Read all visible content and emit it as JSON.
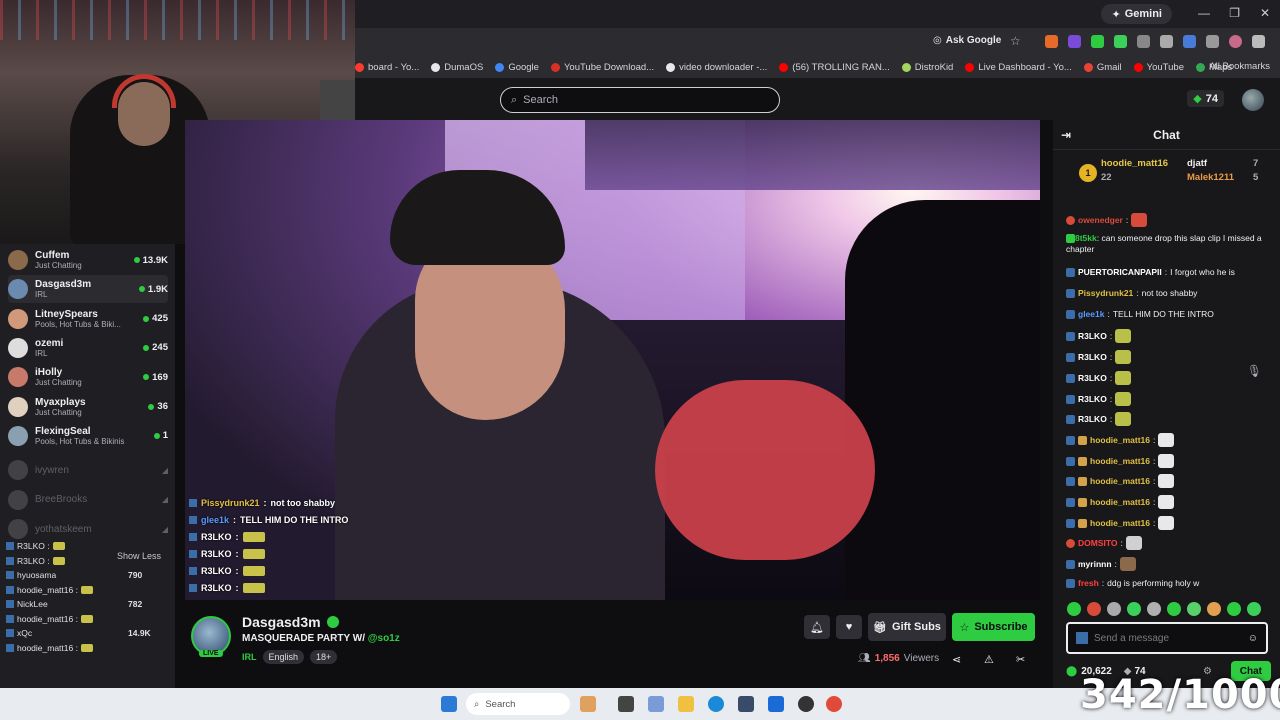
{
  "browser": {
    "gemini_label": "Gemini",
    "ask_google": "Ask Google",
    "bookmarks": [
      {
        "label": "board - Yo...",
        "color": "#ff3b30"
      },
      {
        "label": "DumaOS",
        "color": "#e8e8ea"
      },
      {
        "label": "Google",
        "color": "#4285f4"
      },
      {
        "label": "YouTube Download...",
        "color": "#d93025"
      },
      {
        "label": "video downloader -...",
        "color": "#e8e8ea"
      },
      {
        "label": "(56) TROLLING RAN...",
        "color": "#ff0000"
      },
      {
        "label": "DistroKid",
        "color": "#a3d65c"
      },
      {
        "label": "Live Dashboard - Yo...",
        "color": "#ff0000"
      },
      {
        "label": "Gmail",
        "color": "#ea4335"
      },
      {
        "label": "YouTube",
        "color": "#ff0000"
      },
      {
        "label": "Maps",
        "color": "#34a853"
      }
    ],
    "all_bookmarks": "All Bookmarks"
  },
  "topbar": {
    "search_placeholder": "Search",
    "bits_count": "74"
  },
  "sidebar": {
    "channels": [
      {
        "name": "Cuffem",
        "category": "Just Chatting",
        "viewers": "13.9K",
        "color": "#8a6a4a"
      },
      {
        "name": "Dasgasd3m",
        "category": "IRL",
        "viewers": "1.9K",
        "color": "#6a8ab0"
      },
      {
        "name": "LitneySpears",
        "category": "Pools, Hot Tubs & Biki...",
        "viewers": "425",
        "color": "#d09a7a"
      },
      {
        "name": "ozemi",
        "category": "IRL",
        "viewers": "245",
        "color": "#ddd"
      },
      {
        "name": "iHolly",
        "category": "Just Chatting",
        "viewers": "169",
        "color": "#c87a6a"
      },
      {
        "name": "Myaxplays",
        "category": "Just Chatting",
        "viewers": "36",
        "color": "#e0d0c0"
      },
      {
        "name": "FlexingSeal",
        "category": "Pools, Hot Tubs & Bikinis",
        "viewers": "1",
        "color": "#8aa0b0"
      }
    ],
    "offline": [
      {
        "name": "ivywren"
      },
      {
        "name": "BreeBrooks"
      },
      {
        "name": "yothatskeem"
      }
    ],
    "show_less": "Show Less",
    "overlay_lines": [
      {
        "text": "R3LKO :"
      },
      {
        "text": "R3LKO :"
      },
      {
        "text": "hyuosama",
        "count": "790"
      },
      {
        "text": "hoodie_matt16 :"
      },
      {
        "text": "NickLee",
        "count": "782"
      },
      {
        "text": "hoodie_matt16 :"
      },
      {
        "text": "xQc",
        "count": "14.9K"
      },
      {
        "text": "hoodie_matt16 :"
      }
    ]
  },
  "video_chat": [
    {
      "name": "Pissydrunk21",
      "text": "not too shabby",
      "color": "#e0c040"
    },
    {
      "name": "glee1k",
      "text": "TELL HIM DO THE INTRO",
      "color": "#5a9aff"
    },
    {
      "name": "R3LKO",
      "text": "",
      "color": "#ffffff"
    },
    {
      "name": "R3LKO",
      "text": "",
      "color": "#ffffff"
    },
    {
      "name": "R3LKO",
      "text": "",
      "color": "#ffffff"
    },
    {
      "name": "R3LKO",
      "text": "",
      "color": "#ffffff"
    }
  ],
  "stream": {
    "streamer_name": "Dasgasd3m",
    "title": "MASQUERADE PARTY W/",
    "title_mention": "@so1z",
    "category": "IRL",
    "tags": [
      "English",
      "18+"
    ],
    "live_label": "LIVE",
    "gift_subs": "Gift Subs",
    "subscribe": "Subscribe",
    "viewers": "1,856",
    "viewers_label": "Viewers"
  },
  "chat": {
    "header": "Chat",
    "leaderboard": {
      "rank": "1",
      "first": {
        "name": "hoodie_matt16",
        "count": "22"
      },
      "second": {
        "name": "djatf",
        "count": "7"
      },
      "third": {
        "name": "Malek1211",
        "count": "5"
      }
    },
    "messages": [
      {
        "name": "owenedger",
        "text": "",
        "color": "#d84a3a"
      },
      {
        "name": "8t5kk",
        "text": "can someone drop this slap clip I missed a chapter",
        "color": "#2ecc40"
      },
      {
        "name": "PUERTORICANPAPII",
        "text": "I forgot who he is",
        "color": "#ffffff"
      },
      {
        "name": "Pissydrunk21",
        "text": "not too shabby",
        "color": "#e0c040"
      },
      {
        "name": "glee1k",
        "text": "TELL HIM DO THE INTRO",
        "color": "#5a9aff"
      },
      {
        "name": "R3LKO",
        "text": "",
        "color": "#ffffff"
      },
      {
        "name": "R3LKO",
        "text": "",
        "color": "#ffffff"
      },
      {
        "name": "R3LKO",
        "text": "",
        "color": "#ffffff"
      },
      {
        "name": "R3LKO",
        "text": "",
        "color": "#ffffff"
      },
      {
        "name": "R3LKO",
        "text": "",
        "color": "#ffffff"
      },
      {
        "name": "hoodie_matt16",
        "text": "",
        "color": "#e0c040"
      },
      {
        "name": "hoodie_matt16",
        "text": "",
        "color": "#e0c040"
      },
      {
        "name": "hoodie_matt16",
        "text": "",
        "color": "#e0c040"
      },
      {
        "name": "hoodie_matt16",
        "text": "",
        "color": "#e0c040"
      },
      {
        "name": "hoodie_matt16",
        "text": "",
        "color": "#e0c040"
      },
      {
        "name": "DOMSITO",
        "text": "",
        "color": "#ff4040"
      },
      {
        "name": "myrinnn",
        "text": "",
        "color": "#ffffff"
      },
      {
        "name": "fresh",
        "text": "ddg is performing holy w",
        "color": "#ff4040"
      }
    ],
    "input_placeholder": "Send a message",
    "points": "20,622",
    "bits": "74",
    "send_label": "Chat"
  },
  "taskbar": {
    "search_placeholder": "Search"
  },
  "overlay_counter": "342/1000"
}
